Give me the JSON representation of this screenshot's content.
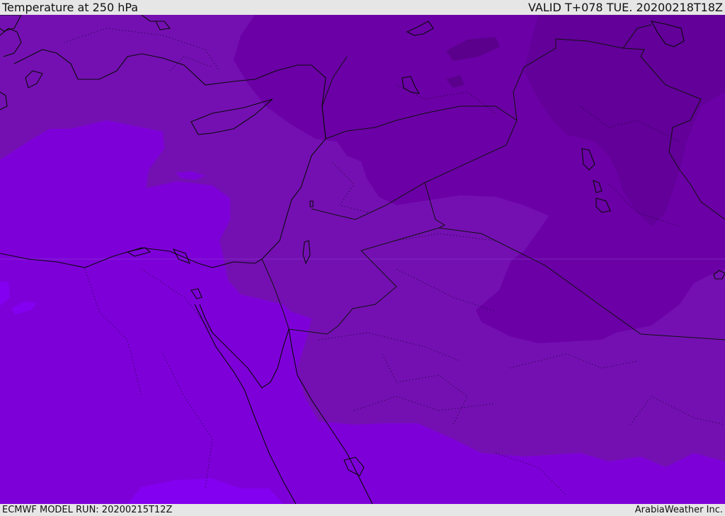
{
  "header": {
    "title": "Temperature at 250 hPa",
    "valid": "VALID T+078 TUE. 20200218T18Z"
  },
  "footer": {
    "model_run": "ECMWF MODEL RUN: 20200215T12Z",
    "credit": "ArabiaWeather Inc."
  },
  "map": {
    "product": "temperature-250hpa",
    "level_hpa": 250,
    "colors": {
      "coldest": "#620099",
      "colder": "#6b00a6",
      "cold": "#7410b2",
      "mild": "#7e00d9",
      "warm": "#8400f0",
      "pocket": "#5a008c",
      "coast": "#0a0a0a",
      "border": "#111111"
    }
  }
}
